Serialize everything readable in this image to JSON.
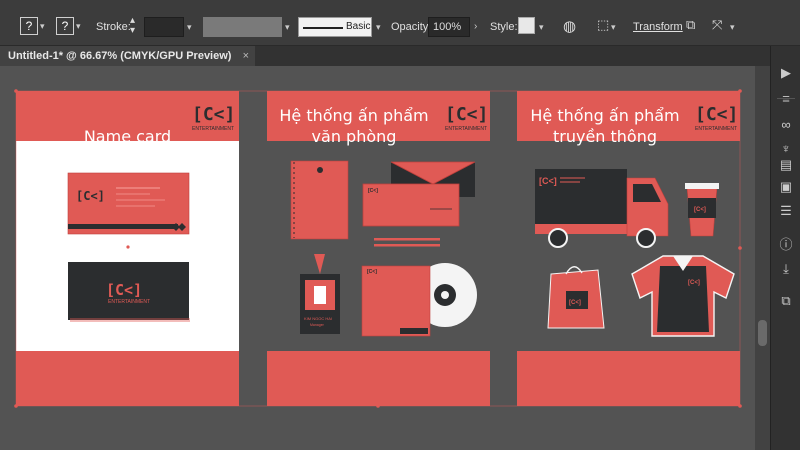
{
  "control_bar": {
    "fill_label": "?",
    "stroke_swatch_label": "?",
    "stroke_label": "Stroke:",
    "stroke_value": "",
    "brush_label": "Basic",
    "opacity_label": "Opacity:",
    "opacity_value": "100%",
    "style_label": "Style:",
    "transform_label": "Transform"
  },
  "document_tab": {
    "title": "Untitled-1* @ 66.67% (CMYK/GPU Preview)",
    "close": "×"
  },
  "artboards": {
    "card": {
      "title": "Name card",
      "logo_text": "[C<]",
      "logo_sub": "ENTERTAINMENT"
    },
    "office": {
      "title_line1": "Hệ thống ấn phẩm",
      "title_line2": "văn phòng",
      "logo_text": "[C<]",
      "logo_sub": "ENTERTAINMENT",
      "badge_name": "KIM NGOC HAI",
      "badge_role": "Manager"
    },
    "media": {
      "title_line1": "Hệ thống ấn phẩm",
      "title_line2": "truyền thông",
      "logo_text": "[C<]",
      "logo_sub": "ENTERTAINMENT"
    }
  },
  "colors": {
    "brand_red": "#e05a55",
    "dark": "#2b2d2f",
    "panel": "#323232",
    "canvas": "#535353"
  },
  "right_panel_icons": [
    "play-icon",
    "menu-icon",
    "link-icon",
    "puppet-icon",
    "layers-icon",
    "gradient-icon",
    "pattern-icon",
    "info-icon",
    "export-icon",
    "artboard-icon"
  ]
}
